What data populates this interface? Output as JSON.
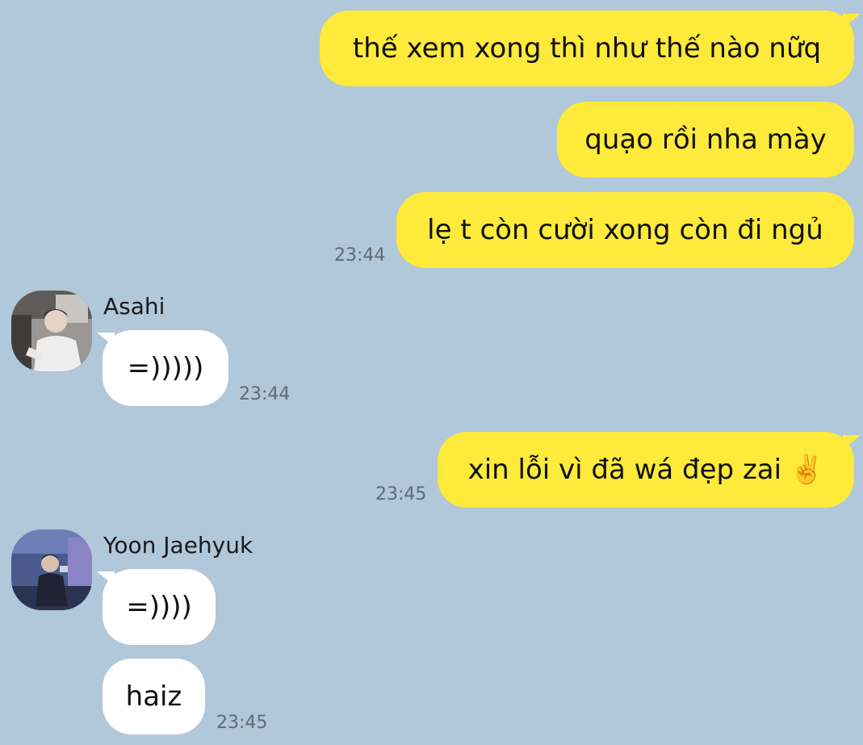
{
  "messages": [
    {
      "sender": "me",
      "text": "thế xem xong thì như thế nào nữq"
    },
    {
      "sender": "me",
      "text": "quạo rồi nha mày"
    },
    {
      "sender": "me",
      "text": "lẹ t còn cười xong còn đi ngủ",
      "time": "23:44"
    },
    {
      "sender": "Asahi",
      "text": "=)))))",
      "time": "23:44"
    },
    {
      "sender": "me",
      "text": "xin lỗi vì đã wá đẹp zai",
      "emoji": "✌️",
      "time": "23:45"
    },
    {
      "sender": "Yoon Jaehyuk",
      "text": "=))))"
    },
    {
      "sender": "Yoon Jaehyuk",
      "text": "haiz",
      "time": "23:45"
    }
  ],
  "contacts": {
    "asahi": {
      "name": "Asahi"
    },
    "jaehyuk": {
      "name": "Yoon Jaehyuk"
    }
  },
  "colors": {
    "background": "#b1c7da",
    "my_bubble": "#fdea3a",
    "their_bubble": "#ffffff",
    "timestamp": "#5f6b75"
  }
}
